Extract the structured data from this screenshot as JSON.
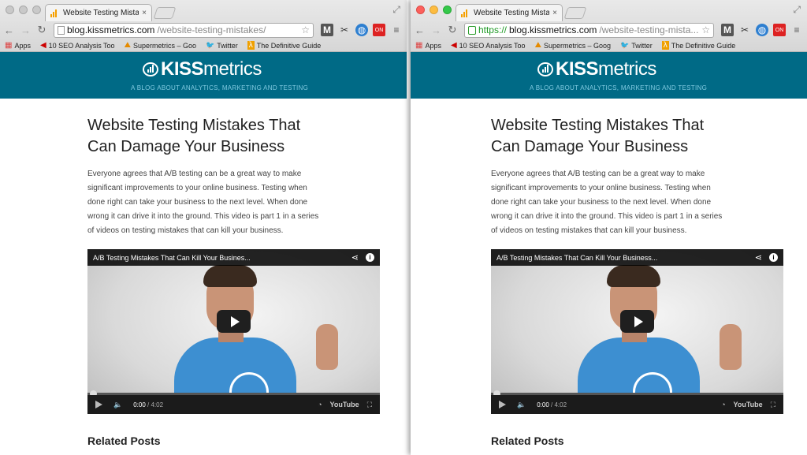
{
  "left": {
    "tab": {
      "title": "Website Testing Mistakes T",
      "close": "×"
    },
    "omnibox": {
      "host": "blog.kissmetrics.com",
      "path": "/website-testing-mistakes/"
    },
    "bookmarks": [
      {
        "icon": "apps-grid-icon",
        "glyph": "▦",
        "label": "Apps"
      },
      {
        "icon": "red-flag-icon",
        "glyph": "◀",
        "label": "10 SEO Analysis Too"
      },
      {
        "icon": "supermetrics-icon",
        "glyph": "⛰",
        "label": "Supermetrics – Goo"
      },
      {
        "icon": "twitter-bird-icon",
        "glyph": "🐦",
        "label": "Twitter"
      },
      {
        "icon": "lambda-icon",
        "glyph": "λ",
        "label": "The Definitive Guide"
      }
    ],
    "header": {
      "logo_kiss": "KISS",
      "logo_metrics": "metrics",
      "tagline": "A BLOG ABOUT ANALYTICS, MARKETING AND TESTING"
    },
    "article": {
      "title": "Website Testing Mistakes That Can Damage Your Business",
      "intro": "Everyone agrees that A/B testing can be a great way to make significant improvements to your online business. Testing when done right can take your business to the next level. When done wrong it can drive it into the ground. This video is part 1 in a series of videos on testing mistakes that can kill your business.",
      "video_title": "A/B Testing Mistakes That Can Kill Your Busines...",
      "time_current": "0:00",
      "time_duration": " / 4:02",
      "youtube": "YouTube",
      "progress_fraction": 0.0,
      "related_heading": "Related Posts"
    }
  },
  "right": {
    "tab": {
      "title": "Website Testing Mistakes T",
      "close": "×"
    },
    "omnibox": {
      "protocol": "https://",
      "host": "blog.kissmetrics.com",
      "path": "/website-testing-mista..."
    },
    "bookmarks": [
      {
        "icon": "apps-grid-icon",
        "glyph": "▦",
        "label": "Apps"
      },
      {
        "icon": "red-flag-icon",
        "glyph": "◀",
        "label": "10 SEO Analysis Too"
      },
      {
        "icon": "supermetrics-icon",
        "glyph": "⛰",
        "label": "Supermetrics – Goog"
      },
      {
        "icon": "twitter-bird-icon",
        "glyph": "🐦",
        "label": "Twitter"
      },
      {
        "icon": "lambda-icon",
        "glyph": "λ",
        "label": "The Definitive Guide"
      }
    ],
    "header": {
      "logo_kiss": "KISS",
      "logo_metrics": "metrics",
      "tagline": "A BLOG ABOUT ANALYTICS, MARKETING AND TESTING"
    },
    "article": {
      "title": "Website Testing Mistakes That Can Damage Your Business",
      "intro": "Everyone agrees that A/B testing can be a great way to make significant improvements to your online business. Testing when done right can take your business to the next level. When done wrong it can drive it into the ground. This video is part 1 in a series of videos on testing mistakes that can kill your business.",
      "video_title": "A/B Testing Mistakes That Can Kill Your Business...",
      "time_current": "0:00",
      "time_duration": " / 4:02",
      "youtube": "YouTube",
      "progress_fraction": 0.0,
      "related_heading": "Related Posts"
    }
  },
  "colors": {
    "header_bg": "#006a86",
    "tagline": "#7fc9e0",
    "https_green": "#1e9a25"
  },
  "icons": {
    "back": "back-arrow-icon",
    "forward": "forward-arrow-icon",
    "reload": "reload-icon",
    "star": "bookmark-star-icon",
    "menu": "hamburger-menu-icon"
  }
}
